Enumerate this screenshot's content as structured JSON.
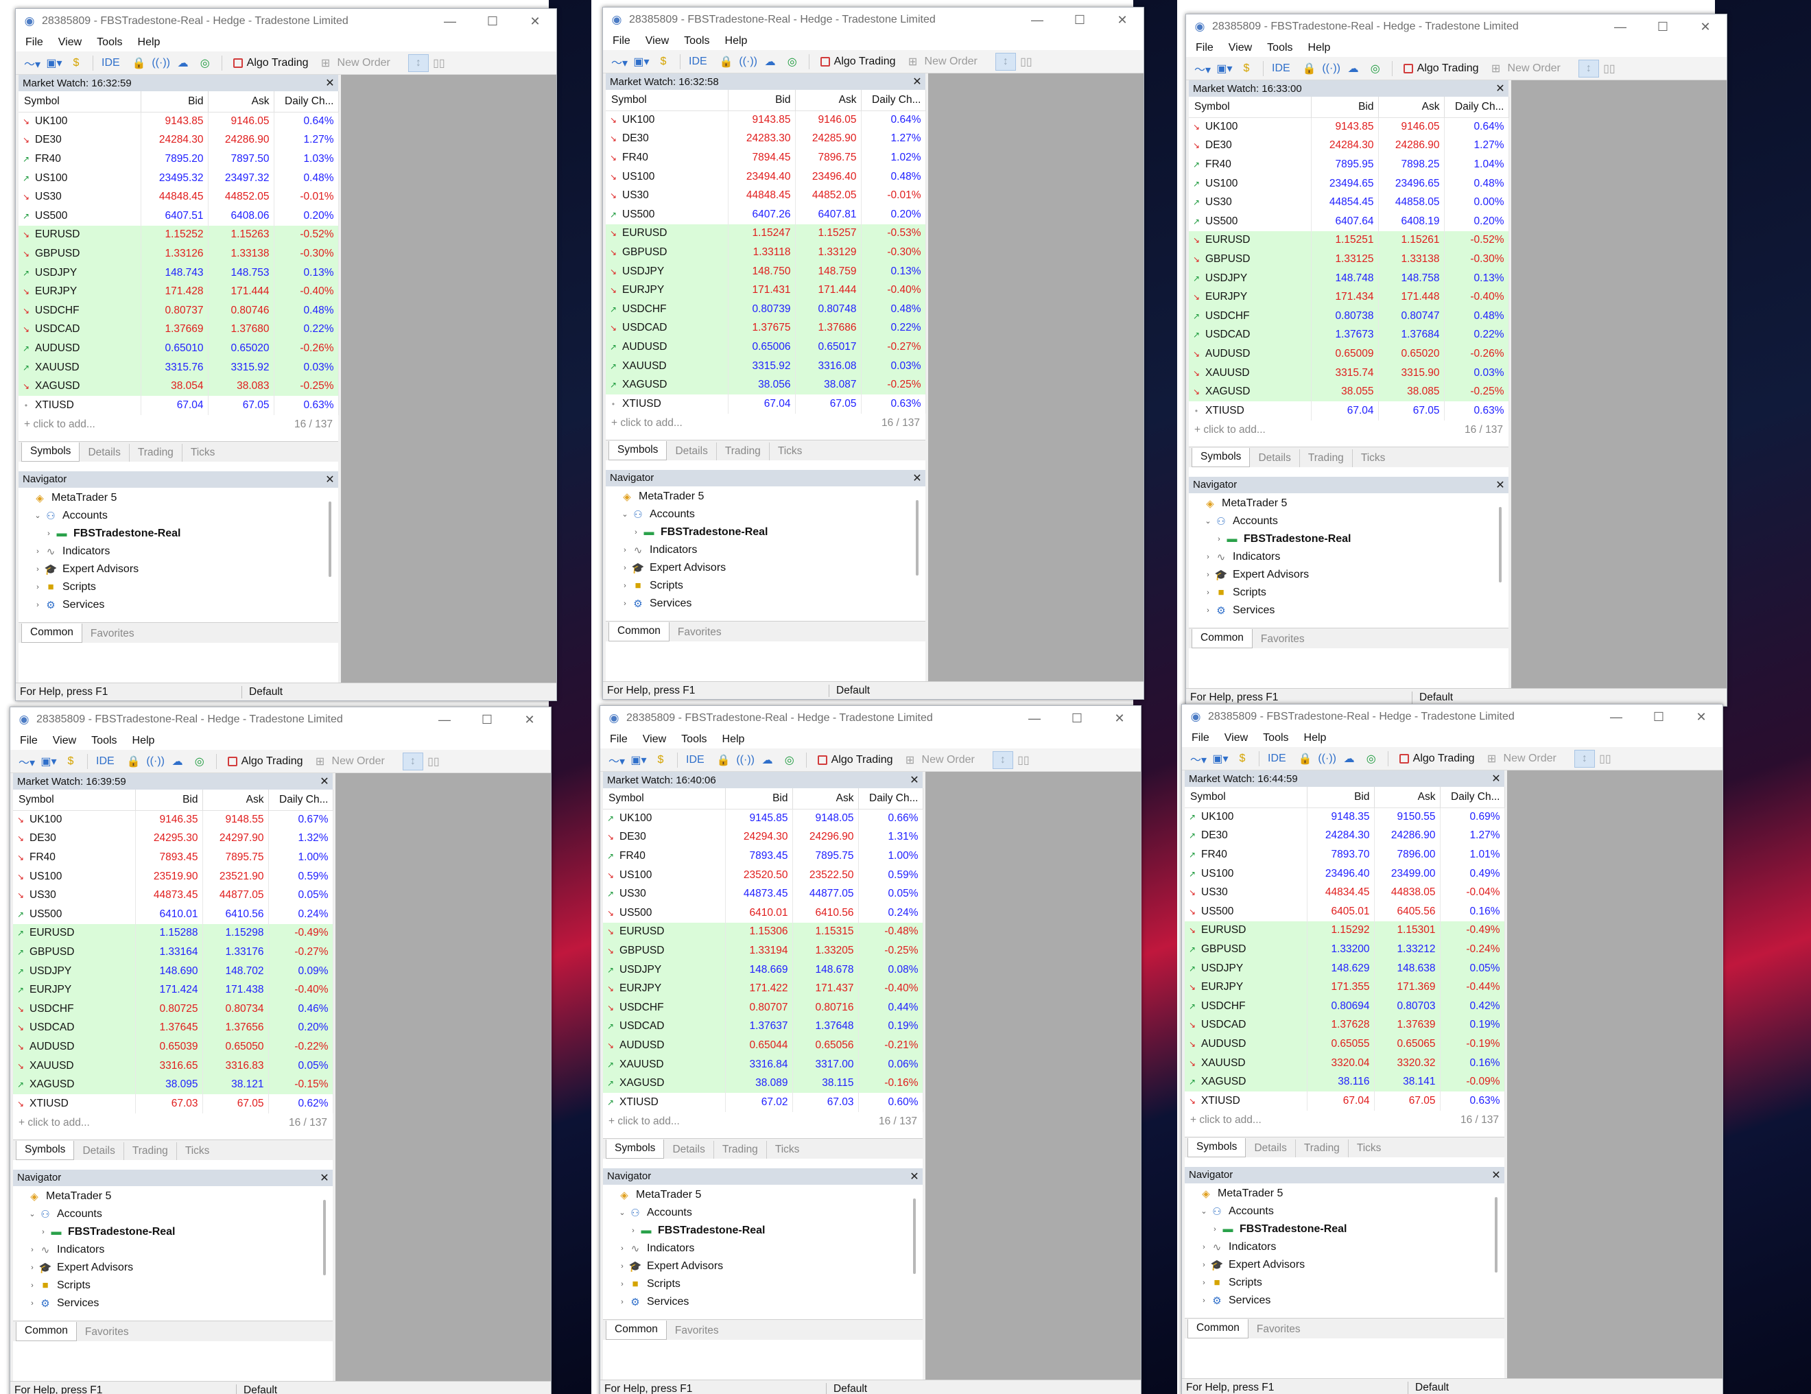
{
  "window_title": "28385809 - FBSTradestone-Real - Hedge - Tradestone Limited",
  "menu": [
    "File",
    "View",
    "Tools",
    "Help"
  ],
  "toolbar": {
    "ide": "IDE",
    "algo_trading": "Algo Trading",
    "new_order": "New Order"
  },
  "market_watch": {
    "headers": [
      "Symbol",
      "Bid",
      "Ask",
      "Daily Ch..."
    ],
    "add_placeholder": "click to add...",
    "count": "16 / 137",
    "tabs": [
      "Symbols",
      "Details",
      "Trading",
      "Ticks"
    ]
  },
  "navigator": {
    "title": "Navigator",
    "items": [
      {
        "label": "MetaTrader 5",
        "icon": "metatrader-icon",
        "level": 0
      },
      {
        "label": "Accounts",
        "icon": "accounts-icon",
        "level": 1
      },
      {
        "label": "FBSTradestone-Real",
        "icon": "account-icon",
        "level": 2
      },
      {
        "label": "Indicators",
        "icon": "indicators-icon",
        "level": 1
      },
      {
        "label": "Expert Advisors",
        "icon": "expert-advisors-icon",
        "level": 1
      },
      {
        "label": "Scripts",
        "icon": "scripts-icon",
        "level": 1
      },
      {
        "label": "Services",
        "icon": "services-icon",
        "level": 1
      }
    ],
    "tabs": [
      "Common",
      "Favorites"
    ]
  },
  "status": {
    "help": "For Help, press F1",
    "profile": "Default"
  },
  "symbols": [
    "UK100",
    "DE30",
    "FR40",
    "US100",
    "US30",
    "US500",
    "EURUSD",
    "GBPUSD",
    "USDJPY",
    "EURJPY",
    "USDCHF",
    "USDCAD",
    "AUDUSD",
    "XAUUSD",
    "XAGUSD",
    "XTIUSD"
  ],
  "windows": [
    {
      "time": "Market Watch: 16:32:59",
      "rows": [
        [
          "9143.85",
          "9146.05",
          "0.64%",
          "d",
          "d"
        ],
        [
          "24284.30",
          "24286.90",
          "1.27%",
          "d",
          "d"
        ],
        [
          "7895.20",
          "7897.50",
          "1.03%",
          "u",
          "u"
        ],
        [
          "23495.32",
          "23497.32",
          "0.48%",
          "u",
          "u"
        ],
        [
          "44848.45",
          "44852.05",
          "-0.01%",
          "d",
          "d"
        ],
        [
          "6407.51",
          "6408.06",
          "0.20%",
          "u",
          "u"
        ],
        [
          "1.15252",
          "1.15263",
          "-0.52%",
          "d",
          "d"
        ],
        [
          "1.33126",
          "1.33138",
          "-0.30%",
          "d",
          "d"
        ],
        [
          "148.743",
          "148.753",
          "0.13%",
          "u",
          "u"
        ],
        [
          "171.428",
          "171.444",
          "-0.40%",
          "d",
          "d"
        ],
        [
          "0.80737",
          "0.80746",
          "0.48%",
          "d",
          "d"
        ],
        [
          "1.37669",
          "1.37680",
          "0.22%",
          "d",
          "d"
        ],
        [
          "0.65010",
          "0.65020",
          "-0.26%",
          "u",
          "u"
        ],
        [
          "3315.76",
          "3315.92",
          "0.03%",
          "u",
          "u"
        ],
        [
          "38.054",
          "38.083",
          "-0.25%",
          "d",
          "d"
        ],
        [
          "67.04",
          "67.05",
          "0.63%",
          "u",
          "n"
        ]
      ]
    },
    {
      "time": "Market Watch: 16:32:58",
      "rows": [
        [
          "9143.85",
          "9146.05",
          "0.64%",
          "d",
          "d"
        ],
        [
          "24283.30",
          "24285.90",
          "1.27%",
          "d",
          "d"
        ],
        [
          "7894.45",
          "7896.75",
          "1.02%",
          "d",
          "d"
        ],
        [
          "23494.40",
          "23496.40",
          "0.48%",
          "d",
          "d"
        ],
        [
          "44848.45",
          "44852.05",
          "-0.01%",
          "d",
          "d"
        ],
        [
          "6407.26",
          "6407.81",
          "0.20%",
          "u",
          "u"
        ],
        [
          "1.15247",
          "1.15257",
          "-0.53%",
          "d",
          "d"
        ],
        [
          "1.33118",
          "1.33129",
          "-0.30%",
          "d",
          "d"
        ],
        [
          "148.750",
          "148.759",
          "0.13%",
          "d",
          "d"
        ],
        [
          "171.431",
          "171.444",
          "-0.40%",
          "d",
          "d"
        ],
        [
          "0.80739",
          "0.80748",
          "0.48%",
          "u",
          "u"
        ],
        [
          "1.37675",
          "1.37686",
          "0.22%",
          "d",
          "d"
        ],
        [
          "0.65006",
          "0.65017",
          "-0.27%",
          "u",
          "u"
        ],
        [
          "3315.92",
          "3316.08",
          "0.03%",
          "u",
          "u"
        ],
        [
          "38.056",
          "38.087",
          "-0.25%",
          "u",
          "u"
        ],
        [
          "67.04",
          "67.05",
          "0.63%",
          "u",
          "n"
        ]
      ]
    },
    {
      "time": "Market Watch: 16:33:00",
      "rows": [
        [
          "9143.85",
          "9146.05",
          "0.64%",
          "d",
          "d"
        ],
        [
          "24284.30",
          "24286.90",
          "1.27%",
          "d",
          "d"
        ],
        [
          "7895.95",
          "7898.25",
          "1.04%",
          "u",
          "u"
        ],
        [
          "23494.65",
          "23496.65",
          "0.48%",
          "u",
          "u"
        ],
        [
          "44854.45",
          "44858.05",
          "0.00%",
          "u",
          "u"
        ],
        [
          "6407.64",
          "6408.19",
          "0.20%",
          "u",
          "u"
        ],
        [
          "1.15251",
          "1.15261",
          "-0.52%",
          "d",
          "d"
        ],
        [
          "1.33125",
          "1.33138",
          "-0.30%",
          "d",
          "d"
        ],
        [
          "148.748",
          "148.758",
          "0.13%",
          "u",
          "u"
        ],
        [
          "171.434",
          "171.448",
          "-0.40%",
          "d",
          "d"
        ],
        [
          "0.80738",
          "0.80747",
          "0.48%",
          "u",
          "u"
        ],
        [
          "1.37673",
          "1.37684",
          "0.22%",
          "u",
          "u"
        ],
        [
          "0.65009",
          "0.65020",
          "-0.26%",
          "d",
          "d"
        ],
        [
          "3315.74",
          "3315.90",
          "0.03%",
          "d",
          "d"
        ],
        [
          "38.055",
          "38.085",
          "-0.25%",
          "d",
          "d"
        ],
        [
          "67.04",
          "67.05",
          "0.63%",
          "u",
          "n"
        ]
      ]
    },
    {
      "time": "Market Watch: 16:39:59",
      "rows": [
        [
          "9146.35",
          "9148.55",
          "0.67%",
          "d",
          "d"
        ],
        [
          "24295.30",
          "24297.90",
          "1.32%",
          "d",
          "d"
        ],
        [
          "7893.45",
          "7895.75",
          "1.00%",
          "d",
          "d"
        ],
        [
          "23519.90",
          "23521.90",
          "0.59%",
          "d",
          "d"
        ],
        [
          "44873.45",
          "44877.05",
          "0.05%",
          "d",
          "d"
        ],
        [
          "6410.01",
          "6410.56",
          "0.24%",
          "u",
          "u"
        ],
        [
          "1.15288",
          "1.15298",
          "-0.49%",
          "u",
          "u"
        ],
        [
          "1.33164",
          "1.33176",
          "-0.27%",
          "u",
          "u"
        ],
        [
          "148.690",
          "148.702",
          "0.09%",
          "u",
          "u"
        ],
        [
          "171.424",
          "171.438",
          "-0.40%",
          "u",
          "u"
        ],
        [
          "0.80725",
          "0.80734",
          "0.46%",
          "d",
          "d"
        ],
        [
          "1.37645",
          "1.37656",
          "0.20%",
          "d",
          "d"
        ],
        [
          "0.65039",
          "0.65050",
          "-0.22%",
          "d",
          "d"
        ],
        [
          "3316.65",
          "3316.83",
          "0.05%",
          "d",
          "d"
        ],
        [
          "38.095",
          "38.121",
          "-0.15%",
          "u",
          "u"
        ],
        [
          "67.03",
          "67.05",
          "0.62%",
          "d",
          "d"
        ]
      ]
    },
    {
      "time": "Market Watch: 16:40:06",
      "rows": [
        [
          "9145.85",
          "9148.05",
          "0.66%",
          "u",
          "u"
        ],
        [
          "24294.30",
          "24296.90",
          "1.31%",
          "d",
          "d"
        ],
        [
          "7893.45",
          "7895.75",
          "1.00%",
          "u",
          "u"
        ],
        [
          "23520.50",
          "23522.50",
          "0.59%",
          "d",
          "d"
        ],
        [
          "44873.45",
          "44877.05",
          "0.05%",
          "u",
          "u"
        ],
        [
          "6410.01",
          "6410.56",
          "0.24%",
          "d",
          "d"
        ],
        [
          "1.15306",
          "1.15315",
          "-0.48%",
          "d",
          "d"
        ],
        [
          "1.33194",
          "1.33205",
          "-0.25%",
          "d",
          "d"
        ],
        [
          "148.669",
          "148.678",
          "0.08%",
          "u",
          "u"
        ],
        [
          "171.422",
          "171.437",
          "-0.40%",
          "d",
          "d"
        ],
        [
          "0.80707",
          "0.80716",
          "0.44%",
          "d",
          "d"
        ],
        [
          "1.37637",
          "1.37648",
          "0.19%",
          "u",
          "u"
        ],
        [
          "0.65044",
          "0.65056",
          "-0.21%",
          "d",
          "d"
        ],
        [
          "3316.84",
          "3317.00",
          "0.06%",
          "u",
          "u"
        ],
        [
          "38.089",
          "38.115",
          "-0.16%",
          "u",
          "u"
        ],
        [
          "67.02",
          "67.03",
          "0.60%",
          "u",
          "u"
        ]
      ]
    },
    {
      "time": "Market Watch: 16:44:59",
      "rows": [
        [
          "9148.35",
          "9150.55",
          "0.69%",
          "u",
          "u"
        ],
        [
          "24284.30",
          "24286.90",
          "1.27%",
          "u",
          "u"
        ],
        [
          "7893.70",
          "7896.00",
          "1.01%",
          "u",
          "u"
        ],
        [
          "23496.40",
          "23499.00",
          "0.49%",
          "u",
          "u"
        ],
        [
          "44834.45",
          "44838.05",
          "-0.04%",
          "d",
          "d"
        ],
        [
          "6405.01",
          "6405.56",
          "0.16%",
          "d",
          "d"
        ],
        [
          "1.15292",
          "1.15301",
          "-0.49%",
          "d",
          "d"
        ],
        [
          "1.33200",
          "1.33212",
          "-0.24%",
          "u",
          "u"
        ],
        [
          "148.629",
          "148.638",
          "0.05%",
          "u",
          "u"
        ],
        [
          "171.355",
          "171.369",
          "-0.44%",
          "d",
          "d"
        ],
        [
          "0.80694",
          "0.80703",
          "0.42%",
          "u",
          "u"
        ],
        [
          "1.37628",
          "1.37639",
          "0.19%",
          "d",
          "d"
        ],
        [
          "0.65055",
          "0.65065",
          "-0.19%",
          "d",
          "d"
        ],
        [
          "3320.04",
          "3320.32",
          "0.16%",
          "d",
          "d"
        ],
        [
          "38.116",
          "38.141",
          "-0.09%",
          "u",
          "u"
        ],
        [
          "67.04",
          "67.05",
          "0.63%",
          "d",
          "d"
        ]
      ]
    }
  ]
}
